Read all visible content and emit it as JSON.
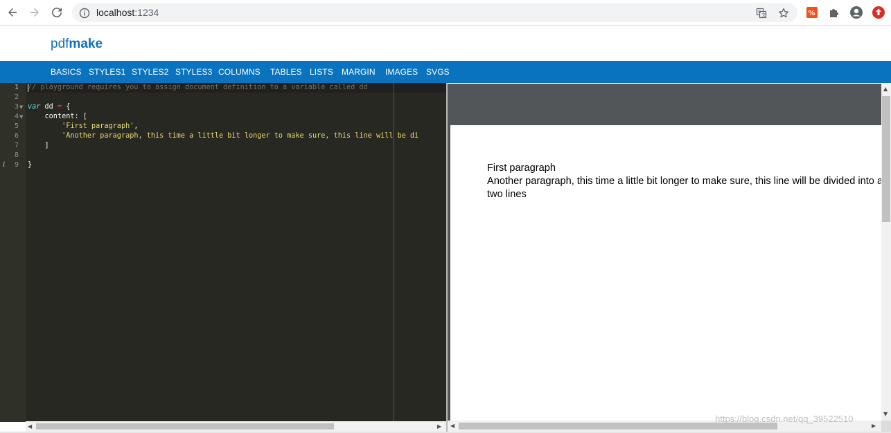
{
  "browser": {
    "url_host": "localhost",
    "url_port": ":1234",
    "icons": [
      "back-icon",
      "forward-icon",
      "reload-icon",
      "info-icon",
      "translate-icon",
      "star-icon",
      "extension-red-icon",
      "puzzle-icon",
      "profile-icon",
      "update-icon"
    ]
  },
  "app": {
    "brand_prefix": "pdf",
    "brand_suffix": "make",
    "brand_color": "#0e6fbf",
    "nav_color": "#0a73c0",
    "nav": [
      "BASICS",
      "STYLES1",
      "STYLES2",
      "STYLES3",
      "COLUMNS",
      "TABLES",
      "LISTS",
      "MARGIN",
      "IMAGES",
      "SVGS"
    ]
  },
  "editor": {
    "line_numbers": [
      "1",
      "2",
      "3",
      "4",
      "5",
      "6",
      "7",
      "8",
      "9"
    ],
    "lines": {
      "l1": "// playground requires you to assign document definition to a variable called dd",
      "l3_kw": "var",
      "l3_name": " dd ",
      "l3_op": "=",
      "l3_rest": " {",
      "l4": "    content: [",
      "l5_indent": "        ",
      "l5_str": "'First paragraph'",
      "l5_rest": ",",
      "l6_indent": "        ",
      "l6_str": "'Another paragraph, this time a little bit longer to make sure, this line will be di",
      "l7": "    ]",
      "l9": "}"
    },
    "info_marker": "i"
  },
  "preview": {
    "line1": "First paragraph",
    "line2": "Another paragraph, this time a little bit longer to make sure, this line will be divided into at least",
    "line3": "two lines"
  },
  "watermark": "https://blog.csdn.net/qq_39522510"
}
